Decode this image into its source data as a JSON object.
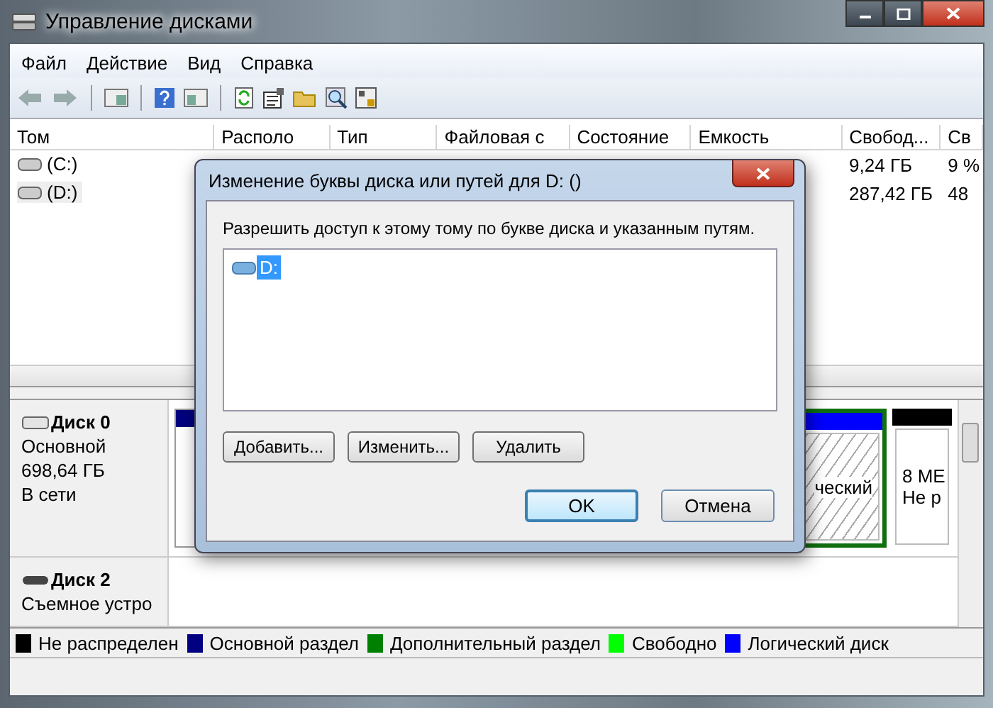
{
  "window": {
    "title": "Управление дисками"
  },
  "menu": [
    "Файл",
    "Действие",
    "Вид",
    "Справка"
  ],
  "volumes": {
    "columns": [
      "Том",
      "Располо",
      "Тип",
      "Файловая с",
      "Состояние",
      "Емкость",
      "Свобод...",
      "Св"
    ],
    "rows": [
      {
        "volume": "(C:)",
        "selected": false,
        "free": "9,24 ГБ",
        "free_percent": "9 %"
      },
      {
        "volume": "(D:)",
        "selected": true,
        "free": "287,42 ГБ",
        "free_percent": "48"
      }
    ]
  },
  "disks": [
    {
      "kind": "fixed",
      "name": "Диск 0",
      "type": "Основной",
      "size": "698,64 ГБ",
      "status": "В сети",
      "partitions": [
        {
          "kind": "primary"
        },
        {
          "kind": "logical",
          "lines": [
            "ческий"
          ]
        },
        {
          "kind": "unallocated",
          "lines": [
            "8 МЕ",
            "Не р"
          ]
        }
      ]
    },
    {
      "kind": "removable",
      "name": "Диск 2",
      "type": "Съемное устро"
    }
  ],
  "legend": [
    {
      "label": "Не распределен",
      "color": "#000000"
    },
    {
      "label": "Основной раздел",
      "color": "#000080"
    },
    {
      "label": "Дополнительный раздел",
      "color": "#008000"
    },
    {
      "label": "Свободно",
      "color": "#00ff00"
    },
    {
      "label": "Логический диск",
      "color": "#0000ff"
    }
  ],
  "dialog": {
    "title": "Изменение буквы диска или путей для D: ()",
    "prompt": "Разрешить доступ к этому тому по букве диска и указанным путям.",
    "paths": [
      {
        "label": "D:",
        "selected": true
      }
    ],
    "buttons": [
      "Добавить...",
      "Изменить...",
      "Удалить"
    ],
    "actions": [
      {
        "label": "OK",
        "default": true
      },
      {
        "label": "Отмена",
        "default": false
      }
    ]
  }
}
